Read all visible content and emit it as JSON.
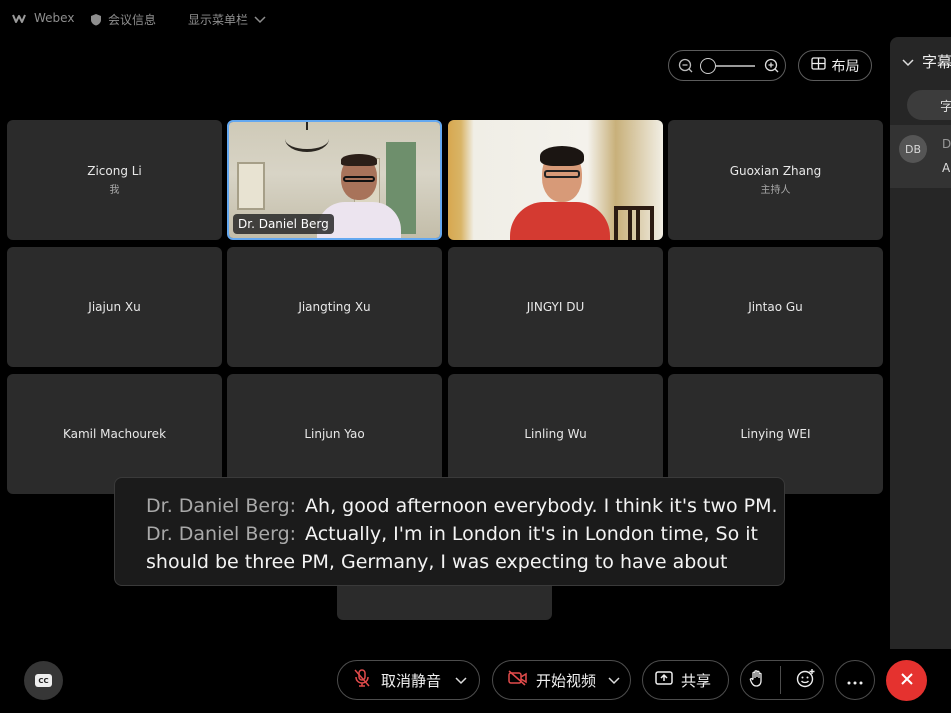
{
  "titlebar": {
    "app_name": "Webex",
    "meeting_info": "会议信息",
    "show_menu": "显示菜单栏"
  },
  "toolbar_top": {
    "layout_label": "布局"
  },
  "participants": [
    {
      "name": "Zicong Li",
      "sub": "我"
    },
    {
      "name": "Dr. Daniel Berg",
      "sub": ""
    },
    {
      "name": "",
      "sub": ""
    },
    {
      "name": "Guoxian Zhang",
      "sub": "主持人"
    },
    {
      "name": "Jiajun Xu",
      "sub": ""
    },
    {
      "name": "Jiangting Xu",
      "sub": ""
    },
    {
      "name": "JINGYI DU",
      "sub": ""
    },
    {
      "name": "Jintao Gu",
      "sub": ""
    },
    {
      "name": "Kamil Machourek",
      "sub": ""
    },
    {
      "name": "Linjun Yao",
      "sub": ""
    },
    {
      "name": "Linling Wu",
      "sub": ""
    },
    {
      "name": "Linying WEI",
      "sub": ""
    }
  ],
  "captions": [
    {
      "speaker": "Dr. Daniel Berg:",
      "text": "Ah, good afternoon everybody. I think it's two PM."
    },
    {
      "speaker": "Dr. Daniel Berg:",
      "text": "Actually, I'm in London it's in London time, So it"
    },
    {
      "speaker": "",
      "text": "should be three PM, Germany, I was expecting to have about"
    }
  ],
  "side_panel": {
    "title": "字幕",
    "tab": "字",
    "avatar_initials": "DB",
    "row_name": "D",
    "row_text": "A"
  },
  "controls": {
    "unmute": "取消静音",
    "start_video": "开始视频",
    "share": "共享",
    "cc_label": "CC",
    "end_color": "#e5322f"
  },
  "colors": {
    "active_border": "#64a8f0",
    "tile_bg": "#2b2b2b"
  }
}
